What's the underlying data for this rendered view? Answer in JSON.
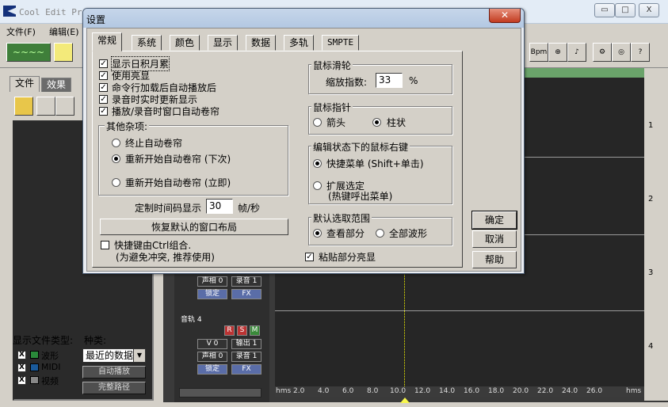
{
  "app": {
    "title": "Cool Edit Pro",
    "menu": [
      "文件(F)",
      "编辑(E)"
    ],
    "window_controls": [
      "▭",
      "□",
      "X"
    ]
  },
  "left_panel": {
    "tabs": [
      "文件",
      "效果"
    ],
    "file_type_label": "显示文件类型:",
    "category_label": "种类:",
    "file_types": [
      "波形",
      "MIDI",
      "视频"
    ],
    "category_value": "最近的数据",
    "auto_play": "自动播放",
    "full_path": "完整路径"
  },
  "tracks": {
    "numbers": [
      "1",
      "2",
      "3",
      "4"
    ],
    "track4_name": "音轨 4",
    "rsm": [
      "R",
      "S",
      "M"
    ],
    "vol": "V 0",
    "out": "输出 1",
    "pan": "声相 0",
    "rec": "录音 1",
    "lock": "锁定",
    "fx": "FX",
    "ruler": [
      "hms",
      "2.0",
      "4.0",
      "6.0",
      "8.0",
      "10.0",
      "12.0",
      "14.0",
      "16.0",
      "18.0",
      "20.0",
      "22.0",
      "24.0",
      "26.0",
      "hms"
    ]
  },
  "dialog": {
    "title": "设置",
    "close": "✕",
    "tabs": [
      "常规",
      "系统",
      "颜色",
      "显示",
      "数据",
      "多轨",
      "SMPTE"
    ],
    "checkboxes": [
      {
        "label": "显示日积月累",
        "checked": true
      },
      {
        "label": "使用亮显",
        "checked": true
      },
      {
        "label": "命令行加载后自动播放后",
        "checked": true
      },
      {
        "label": "录音时实时更新显示",
        "checked": true
      },
      {
        "label": "播放/录音时窗口自动卷帘",
        "checked": true
      }
    ],
    "misc_group": "其他杂项:",
    "misc_options": [
      {
        "label": "终止自动卷帘",
        "selected": false
      },
      {
        "label": "重新开始自动卷帘 (下次)",
        "selected": true
      },
      {
        "label": "重新开始自动卷帘 (立即)",
        "selected": false
      }
    ],
    "timecode_label": "定制时间码显示",
    "timecode_value": "30",
    "timecode_unit": "帧/秒",
    "restore_button": "恢复默认的窗口布局",
    "ctrl_shortcut": {
      "label": "快捷键由Ctrl组合.",
      "note": "(为避免冲突, 推荐使用)",
      "checked": false
    },
    "wheel_group": "鼠标滑轮",
    "zoom_label": "缩放指数:",
    "zoom_value": "33",
    "zoom_unit": "%",
    "pointer_group": "鼠标指针",
    "pointer_options": [
      {
        "label": "箭头",
        "selected": false
      },
      {
        "label": "柱状",
        "selected": true
      }
    ],
    "rightclick_group": "编辑状态下的鼠标右键",
    "rightclick_options": [
      {
        "label": "快捷菜单 (Shift+单击)",
        "selected": true
      },
      {
        "label": "扩展选定",
        "sub": "(热键呼出菜单)",
        "selected": false
      }
    ],
    "range_group": "默认选取范围",
    "range_options": [
      {
        "label": "查看部分",
        "selected": true
      },
      {
        "label": "全部波形",
        "selected": false
      }
    ],
    "paste_highlight": {
      "label": "粘贴部分亮显",
      "checked": true
    },
    "ok": "确定",
    "cancel": "取消",
    "help": "帮助"
  }
}
